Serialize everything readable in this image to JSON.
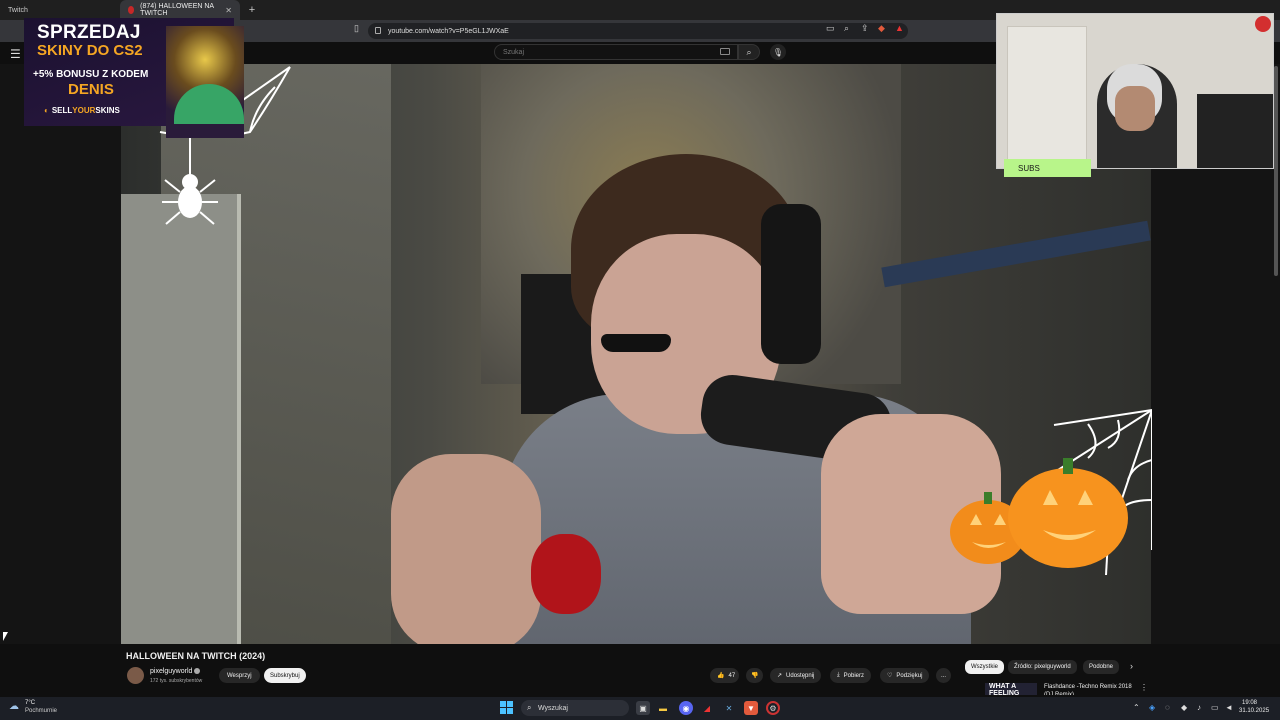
{
  "browser": {
    "tabs": [
      {
        "label": "Twitch"
      },
      {
        "label": "(874) HALLOWEEN NA TWITCH"
      }
    ],
    "url": "youtube.com/watch?v=P5eGL1JWXaE"
  },
  "youtube": {
    "search_placeholder": "Szukaj",
    "video_title": "HALLOWEEN NA TWITCH (2024)",
    "channel_name": "pixelguyworld",
    "channel_subs": "172 tys. subskrybentów",
    "support_label": "Wesprzyj",
    "subscribe_label": "Subskrybuj",
    "actions": {
      "like_count": "47",
      "share_label": "Udostępnij",
      "download_label": "Pobierz",
      "thanks_label": "Podziękuj",
      "more_label": "..."
    },
    "chips": [
      "Wszystkie",
      "Źródło: pixelguyworld",
      "Podobne"
    ],
    "recommended": {
      "thumb_text": "WHAT A FEELING",
      "title": "Flashdance -Techno Remix 2018 (DJ Remix)"
    }
  },
  "overlay": {
    "promo": {
      "line1": "SPRZEDAJ",
      "line2": "SKINY DO CS2",
      "line3": "+5% BONUSU Z KODEM",
      "line4": "DENIS",
      "brand_prefix": "SELL",
      "brand_mid": "YOUR",
      "brand_suffix": "SKINS"
    },
    "subs_label": "SUBS"
  },
  "taskbar": {
    "weather_temp": "7°C",
    "weather_desc": "Pochmurnie",
    "search_label": "Wyszukaj",
    "time": "19:08",
    "date": "31.10.2025"
  },
  "colors": {
    "accent_orange": "#f5a623",
    "subs_green": "#b8f58a",
    "yt_dark": "#0f0f0f"
  }
}
